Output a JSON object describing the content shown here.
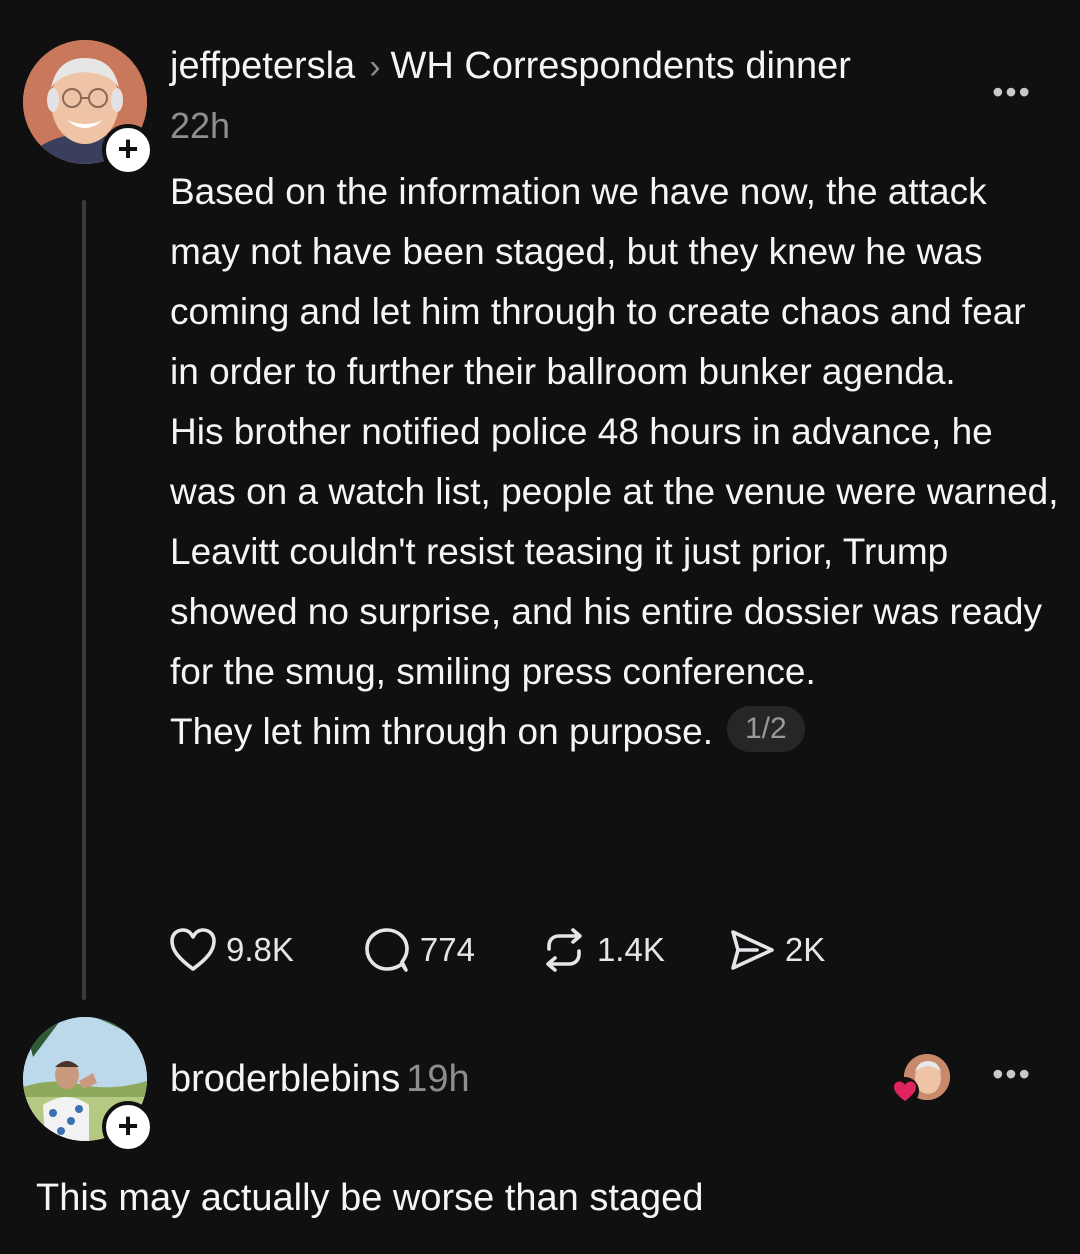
{
  "post": {
    "username": "jeffpetersla",
    "separator": "›",
    "topic": "WH Correspondents dinner",
    "time": "22h",
    "paragraphs": [
      "Based on the information we have now, the attack may not have been staged, but they knew he was coming and let him through to create chaos and fear in order to further their ballroom bunker agenda.",
      "His brother notified police 48 hours in advance, he was on a watch list, people at the venue were warned, Leavitt couldn't resist teasing it just prior, Trump showed no surprise, and his entire dossier was ready for the smug, smiling press conference.",
      "They let him through on purpose."
    ],
    "page_indicator": "1/2",
    "more_label": "•••",
    "follow_label": "+",
    "actions": {
      "likes": "9.8K",
      "replies": "774",
      "reposts": "1.4K",
      "shares": "2K"
    }
  },
  "reply": {
    "username": "broderblebins",
    "time": "19h",
    "text": "This may actually be worse than staged",
    "more_label": "•••",
    "follow_label": "+"
  },
  "icons": {
    "like": "heart-icon",
    "reply": "comment-icon",
    "repost": "repost-icon",
    "share": "send-icon",
    "more": "more-icon",
    "follow": "plus-icon",
    "liked_by": "liked-by-author-icon"
  },
  "colors": {
    "background": "#101010",
    "text_primary": "#f3f5f7",
    "text_secondary": "#8e8e8e",
    "heart_red": "#e0245e"
  }
}
